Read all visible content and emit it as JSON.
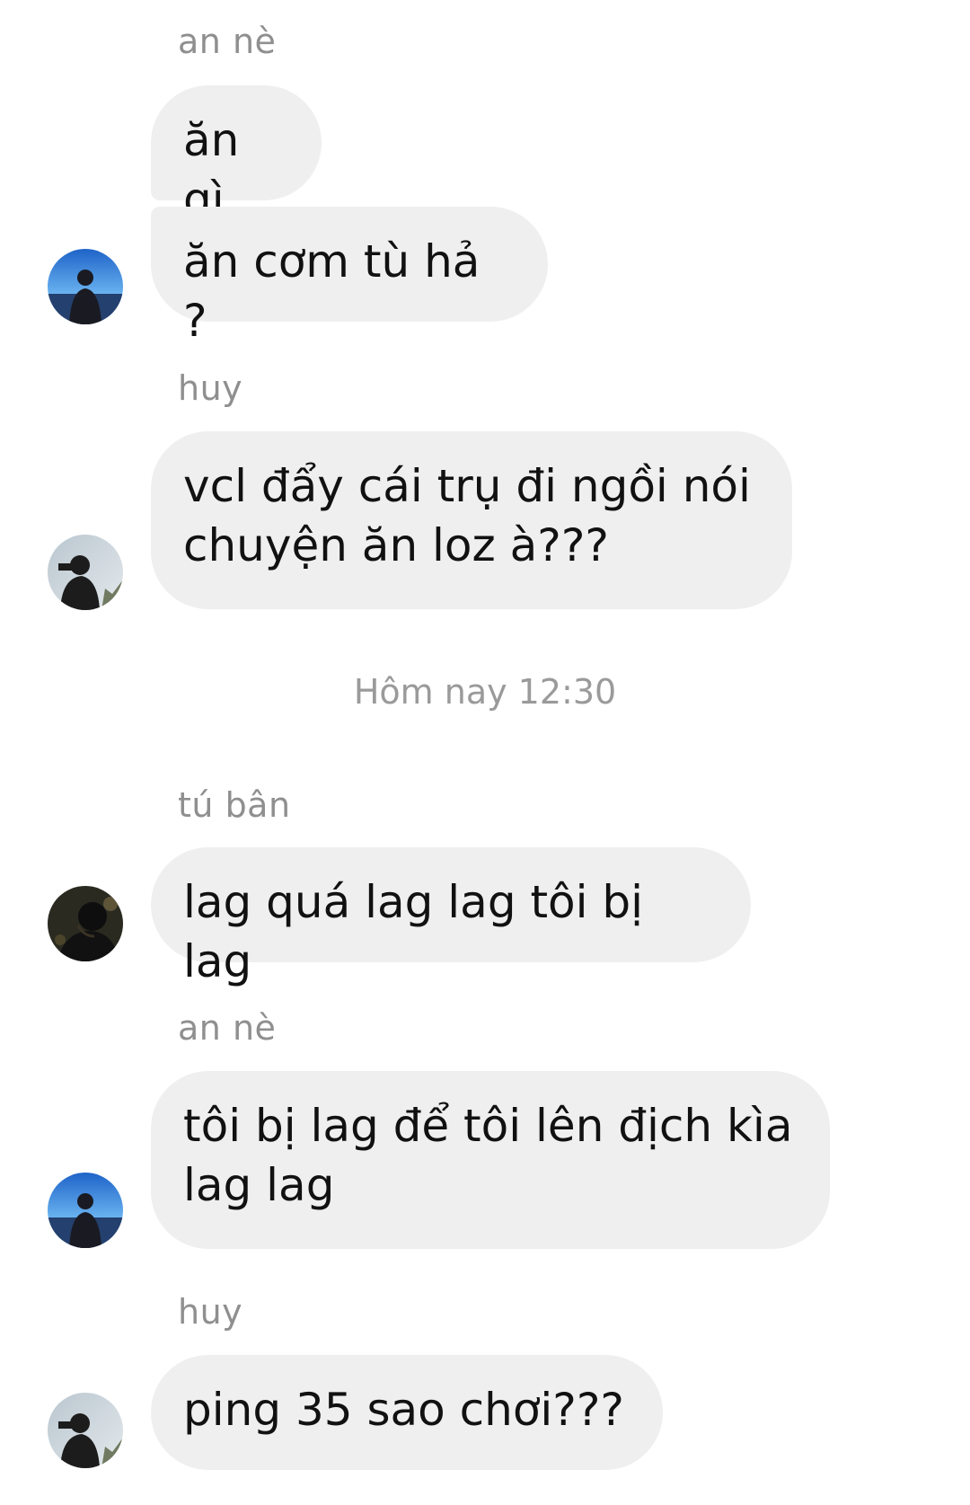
{
  "messages": [
    {
      "sender": "an nè",
      "bubbles": [
        "ăn gì",
        "ăn cơm tù hả ?"
      ]
    },
    {
      "sender": "huy",
      "bubbles": [
        "vcl đẩy cái trụ đi ngồi nói\nchuyện ăn loz à???"
      ]
    },
    {
      "sender": "tú bân",
      "bubbles": [
        "lag quá lag lag tôi bị lag"
      ]
    },
    {
      "sender": "an nè",
      "bubbles": [
        "tôi bị lag để tôi lên địch kìa\nlag lag"
      ]
    },
    {
      "sender": "huy",
      "bubbles": [
        "ping 35 sao chơi???"
      ]
    }
  ],
  "timestamp": "Hôm nay 12:30",
  "avatars": {
    "an": {
      "icon": "avatar-an-icon",
      "sky_top": "#1e63c8",
      "sky_bottom": "#6ab3f0",
      "figure": "#1a1a22"
    },
    "huy": {
      "icon": "avatar-huy-icon",
      "sky_top": "#b9c6cf",
      "sky_bottom": "#dfe6ea",
      "figure": "#1c1c1c"
    },
    "tu": {
      "icon": "avatar-tu-icon",
      "sky_top": "#2a2a20",
      "sky_bottom": "#4a4530",
      "figure": "#0e0e0e"
    }
  }
}
